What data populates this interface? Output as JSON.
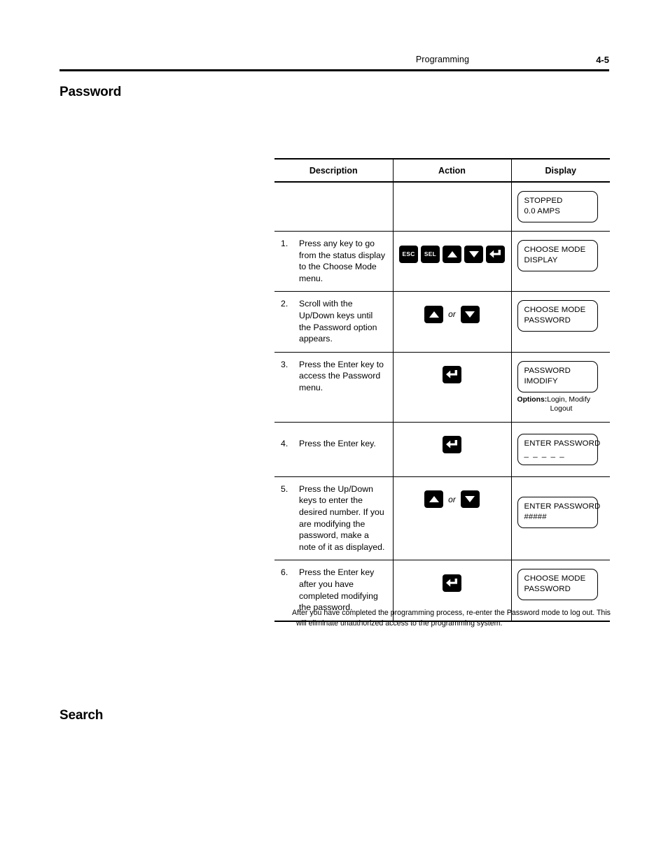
{
  "page": {
    "header_title": "Programming",
    "page_number": "4-5",
    "heading_password": "Password",
    "heading_search": "Search"
  },
  "table": {
    "headers": {
      "description": "Description",
      "action": "Action",
      "display": "Display"
    },
    "rows": [
      {
        "number": "",
        "description": "",
        "keys": [],
        "display_lines": [
          "STOPPED",
          "0.0 AMPS"
        ],
        "options_note": null
      },
      {
        "number": "1.",
        "description": "Press any key to go from the status display to the Choose Mode menu.",
        "keys": [
          "esc-key",
          "sel-key",
          "up-arrow-key",
          "down-arrow-key",
          "enter-key"
        ],
        "key_labels": {
          "esc": "ESC",
          "sel": "SEL"
        },
        "display_lines": [
          "CHOOSE MODE",
          "DISPLAY"
        ],
        "options_note": null
      },
      {
        "number": "2.",
        "description": "Scroll with the Up/Down keys until the Password option appears.",
        "keys": [
          "up-arrow-key",
          "or",
          "down-arrow-key"
        ],
        "display_lines": [
          "CHOOSE MODE",
          "PASSWORD"
        ],
        "options_note": null
      },
      {
        "number": "3.",
        "description": "Press the Enter key to access the Password menu.",
        "keys": [
          "enter-key"
        ],
        "display_lines": [
          "PASSWORD",
          "IMODIFY"
        ],
        "options_note": {
          "label": "Options:",
          "line1": "Login, Modify",
          "line2": "Logout"
        }
      },
      {
        "number": "4.",
        "description": "Press the Enter key.",
        "keys": [
          "enter-key"
        ],
        "display_lines": [
          "ENTER PASSWORD",
          "_ _ _ _ _"
        ],
        "options_note": null
      },
      {
        "number": "5.",
        "description": "Press the Up/Down keys to enter the desired number.  If you are modifying the password, make a note of it as displayed.",
        "keys": [
          "up-arrow-key",
          "or",
          "down-arrow-key"
        ],
        "display_lines": [
          "ENTER PASSWORD",
          "#####"
        ],
        "options_note": null
      },
      {
        "number": "6.",
        "description": "Press the Enter key after you have completed modifying the password.",
        "keys": [
          "enter-key"
        ],
        "display_lines": [
          "CHOOSE MODE",
          "PASSWORD"
        ],
        "options_note": null
      }
    ],
    "footer_note_line1": "After you have completed the programming process, re-enter the Password mode to log out.  This",
    "footer_note_line2": "will eliminate unauthorized access to the programming system."
  },
  "labels": {
    "or": "or",
    "esc": "ESC",
    "sel": "SEL"
  },
  "colors": {
    "text": "#000000",
    "background": "#ffffff",
    "key_fill": "#000000",
    "key_glyph": "#ffffff"
  }
}
